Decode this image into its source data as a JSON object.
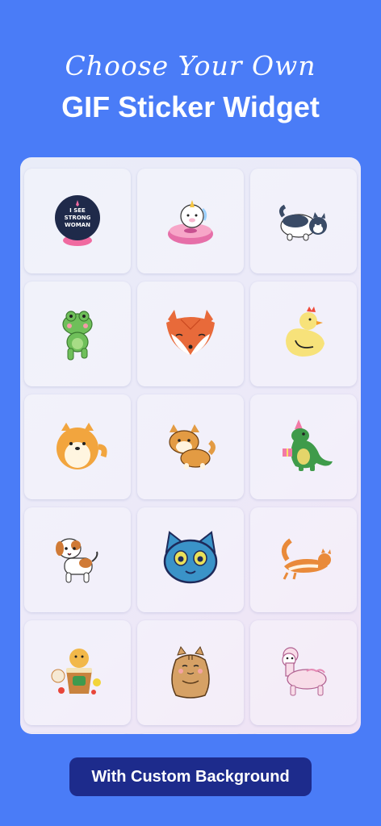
{
  "header": {
    "script_title": "Choose Your Own",
    "main_title": "GIF Sticker Widget"
  },
  "stickers": [
    {
      "name": "strong-woman-globe-sticker",
      "label": "I SEE STRONG WOMAN"
    },
    {
      "name": "unicorn-donut-sticker"
    },
    {
      "name": "husky-dog-sticker"
    },
    {
      "name": "green-frog-sticker"
    },
    {
      "name": "fox-face-sticker"
    },
    {
      "name": "yellow-duck-sticker"
    },
    {
      "name": "pomeranian-dog-sticker"
    },
    {
      "name": "shiba-inu-sticker"
    },
    {
      "name": "party-dinosaur-sticker"
    },
    {
      "name": "puppy-dog-sticker"
    },
    {
      "name": "blue-cat-face-sticker"
    },
    {
      "name": "stretching-orange-cat-sticker"
    },
    {
      "name": "hamster-cake-sticker"
    },
    {
      "name": "chubby-tabby-cat-sticker"
    },
    {
      "name": "pink-alpaca-sticker"
    }
  ],
  "cta": {
    "label": "With Custom Background"
  },
  "colors": {
    "background": "#4a7cf7",
    "button": "#1d2b8c"
  }
}
